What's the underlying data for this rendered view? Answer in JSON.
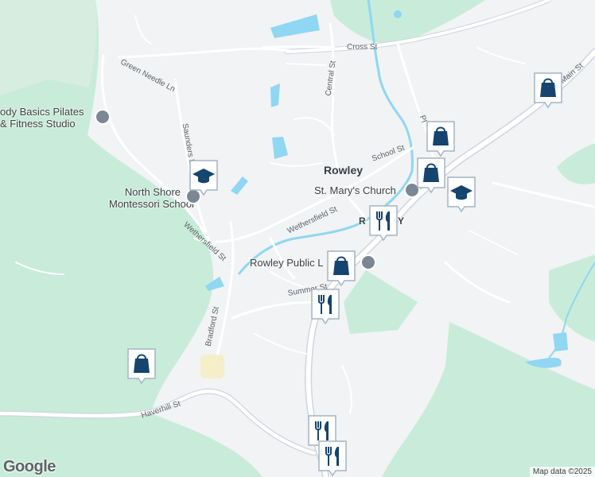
{
  "map": {
    "colors": {
      "land": "#f1f3f4",
      "park": "#c8ecd9",
      "water": "#8fd7f2",
      "road": "#ffffff",
      "road_edge": "#cfd6de",
      "marker_fill": "#ffffff",
      "marker_border": "#a5b4c4",
      "marker_icon": "#15456e"
    },
    "places": {
      "rowley": "Rowley"
    },
    "roads": {
      "cross_st": "Cross St",
      "green_needle_ln": "Green Needle Ln",
      "central_st": "Central St",
      "saunders_ln": "Saunders Ln",
      "school_st": "School St",
      "wethersfield_st_east": "Wethersfield St",
      "wethersfield_st_west": "Wethersfield St",
      "summer_st": "Summer St",
      "bradford_st": "Bradford St",
      "haverhill_st": "Haverhill St",
      "main_st": "Main St",
      "pleasant_st": "Pl"
    },
    "pois": {
      "body_basics": [
        "ody Basics Pilates",
        "& Fitness Studio"
      ],
      "north_shore_montessori": [
        "North Shore",
        "Montessori School"
      ],
      "st_marys": "St. Mary's Church",
      "library": "Rowley Public L",
      "rowley_partial": "R",
      "rowley_partial_2": "Y"
    },
    "markers": [
      {
        "name": "shopping-bag-marker-1",
        "icon": "shopping-bag-icon"
      },
      {
        "name": "shopping-bag-marker-2",
        "icon": "shopping-bag-icon"
      },
      {
        "name": "shopping-bag-marker-3",
        "icon": "shopping-bag-icon"
      },
      {
        "name": "school-marker-1",
        "icon": "graduation-cap-icon"
      },
      {
        "name": "school-marker-2",
        "icon": "graduation-cap-icon"
      },
      {
        "name": "restaurant-marker-1",
        "icon": "fork-knife-icon"
      },
      {
        "name": "shopping-bag-marker-4",
        "icon": "shopping-bag-icon"
      },
      {
        "name": "restaurant-marker-2",
        "icon": "fork-knife-icon"
      },
      {
        "name": "shopping-bag-marker-5",
        "icon": "shopping-bag-icon"
      },
      {
        "name": "restaurant-marker-3",
        "icon": "fork-knife-icon"
      },
      {
        "name": "restaurant-marker-4",
        "icon": "fork-knife-icon"
      }
    ],
    "logo": "Google",
    "attribution": "Map data ©2025"
  }
}
